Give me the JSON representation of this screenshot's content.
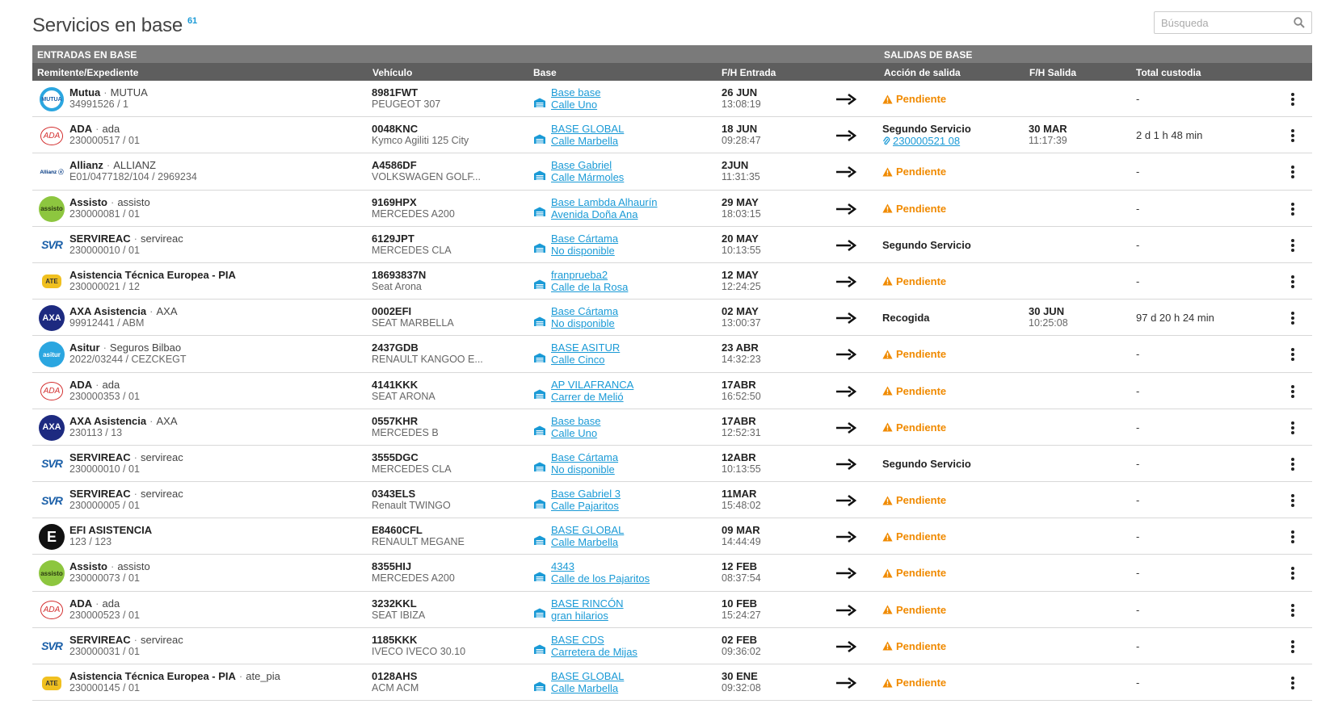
{
  "header": {
    "title": "Servicios en base",
    "count": "61",
    "search_placeholder": "Búsqueda"
  },
  "table": {
    "groups": {
      "entries": "ENTRADAS EN BASE",
      "exits": "SALIDAS DE BASE"
    },
    "columns": {
      "sender": "Remitente/Expediente",
      "vehicle": "Vehículo",
      "base": "Base",
      "entry": "F/H Entrada",
      "action": "Acción de salida",
      "exit": "F/H Salida",
      "total": "Total custodia"
    },
    "rows": [
      {
        "logo": "mutua",
        "name": "Mutua",
        "alias": "MUTUA",
        "file": "34991526 / 1",
        "plate": "8981FWT",
        "model": "PEUGEOT 307",
        "base": "Base base",
        "address": "Calle Uno",
        "entry_date": "26 JUN",
        "entry_time": "13:08:19",
        "action": "Pendiente",
        "action_type": "pending",
        "action_link": "",
        "exit_date": "",
        "exit_time": "",
        "total": "-"
      },
      {
        "logo": "ada",
        "name": "ADA",
        "alias": "ada",
        "file": "230000517 / 01",
        "plate": "0048KNC",
        "model": "Kymco Agiliti 125 City",
        "base": "BASE GLOBAL",
        "address": "Calle Marbella",
        "entry_date": "18 JUN",
        "entry_time": "09:28:47",
        "action": "Segundo Servicio",
        "action_type": "linked",
        "action_link": "230000521 08",
        "exit_date": "30 MAR",
        "exit_time": "11:17:39",
        "total": "2 d 1 h 48 min"
      },
      {
        "logo": "allianz",
        "name": "Allianz",
        "alias": "ALLIANZ",
        "file": "E01/0477182/104 / 2969234",
        "plate": "A4586DF",
        "model": "VOLKSWAGEN GOLF...",
        "base": "Base Gabriel",
        "address": "Calle Mármoles",
        "entry_date": "2JUN",
        "entry_time": "11:31:35",
        "action": "Pendiente",
        "action_type": "pending",
        "action_link": "",
        "exit_date": "",
        "exit_time": "",
        "total": "-"
      },
      {
        "logo": "assisto",
        "name": "Assisto",
        "alias": "assisto",
        "file": "230000081 / 01",
        "plate": "9169HPX",
        "model": "MERCEDES A200",
        "base": "Base Lambda Alhaurín",
        "address": "Avenida Doña Ana",
        "entry_date": "29 MAY",
        "entry_time": "18:03:15",
        "action": "Pendiente",
        "action_type": "pending",
        "action_link": "",
        "exit_date": "",
        "exit_time": "",
        "total": "-"
      },
      {
        "logo": "svr",
        "name": "SERVIREAC",
        "alias": "servireac",
        "file": "230000010 / 01",
        "plate": "6129JPT",
        "model": "MERCEDES CLA",
        "base": "Base Cártama",
        "address": "No disponible",
        "entry_date": "20 MAY",
        "entry_time": "10:13:55",
        "action": "Segundo Servicio",
        "action_type": "text",
        "action_link": "",
        "exit_date": "",
        "exit_time": "",
        "total": "-"
      },
      {
        "logo": "ate",
        "name": "Asistencia Técnica Europea - PIA",
        "alias": "",
        "file": "230000021 / 12",
        "plate": "18693837N",
        "model": "Seat Arona",
        "base": "franprueba2",
        "address": "Calle de la Rosa",
        "entry_date": "12 MAY",
        "entry_time": "12:24:25",
        "action": "Pendiente",
        "action_type": "pending",
        "action_link": "",
        "exit_date": "",
        "exit_time": "",
        "total": "-"
      },
      {
        "logo": "axa",
        "name": "AXA Asistencia",
        "alias": "AXA",
        "file": "99912441 / ABM",
        "plate": "0002EFI",
        "model": "SEAT MARBELLA",
        "base": "Base Cártama",
        "address": "No disponible",
        "entry_date": "02 MAY",
        "entry_time": "13:00:37",
        "action": "Recogida",
        "action_type": "text",
        "action_link": "",
        "exit_date": "30 JUN",
        "exit_time": "10:25:08",
        "total": "97 d 20 h 24 min"
      },
      {
        "logo": "asitur",
        "name": "Asitur",
        "alias": "Seguros Bilbao",
        "file": "2022/03244 / CEZCKEGT",
        "plate": "2437GDB",
        "model": "RENAULT KANGOO E...",
        "base": "BASE ASITUR",
        "address": "Calle Cinco",
        "entry_date": "23 ABR",
        "entry_time": "14:32:23",
        "action": "Pendiente",
        "action_type": "pending",
        "action_link": "",
        "exit_date": "",
        "exit_time": "",
        "total": "-"
      },
      {
        "logo": "ada",
        "name": "ADA",
        "alias": "ada",
        "file": "230000353 / 01",
        "plate": "4141KKK",
        "model": "SEAT ARONA",
        "base": "AP VILAFRANCA",
        "address": "Carrer de Melió",
        "entry_date": "17ABR",
        "entry_time": "16:52:50",
        "action": "Pendiente",
        "action_type": "pending",
        "action_link": "",
        "exit_date": "",
        "exit_time": "",
        "total": "-"
      },
      {
        "logo": "axa",
        "name": "AXA Asistencia",
        "alias": "AXA",
        "file": "230113 / 13",
        "plate": "0557KHR",
        "model": "MERCEDES B",
        "base": "Base base",
        "address": "Calle Uno",
        "entry_date": "17ABR",
        "entry_time": "12:52:31",
        "action": "Pendiente",
        "action_type": "pending",
        "action_link": "",
        "exit_date": "",
        "exit_time": "",
        "total": "-"
      },
      {
        "logo": "svr",
        "name": "SERVIREAC",
        "alias": "servireac",
        "file": "230000010 / 01",
        "plate": "3555DGC",
        "model": "MERCEDES CLA",
        "base": "Base Cártama",
        "address": "No disponible",
        "entry_date": "12ABR",
        "entry_time": "10:13:55",
        "action": "Segundo Servicio",
        "action_type": "text",
        "action_link": "",
        "exit_date": "",
        "exit_time": "",
        "total": "-"
      },
      {
        "logo": "svr",
        "name": "SERVIREAC",
        "alias": "servireac",
        "file": "230000005 / 01",
        "plate": "0343ELS",
        "model": "Renault TWINGO",
        "base": "Base Gabriel 3",
        "address": "Calle Pajaritos",
        "entry_date": "11MAR",
        "entry_time": "15:48:02",
        "action": "Pendiente",
        "action_type": "pending",
        "action_link": "",
        "exit_date": "",
        "exit_time": "",
        "total": "-"
      },
      {
        "logo": "efi",
        "name": "EFI ASISTENCIA",
        "alias": "",
        "file": "123 / 123",
        "plate": "E8460CFL",
        "model": "RENAULT MEGANE",
        "base": "BASE GLOBAL",
        "address": "Calle Marbella",
        "entry_date": "09 MAR",
        "entry_time": "14:44:49",
        "action": "Pendiente",
        "action_type": "pending",
        "action_link": "",
        "exit_date": "",
        "exit_time": "",
        "total": "-"
      },
      {
        "logo": "assisto",
        "name": "Assisto",
        "alias": "assisto",
        "file": "230000073 / 01",
        "plate": "8355HIJ",
        "model": "MERCEDES A200",
        "base": "4343",
        "address": "Calle de los Pajaritos",
        "entry_date": "12 FEB",
        "entry_time": "08:37:54",
        "action": "Pendiente",
        "action_type": "pending",
        "action_link": "",
        "exit_date": "",
        "exit_time": "",
        "total": "-"
      },
      {
        "logo": "ada",
        "name": "ADA",
        "alias": "ada",
        "file": "230000523 / 01",
        "plate": "3232KKL",
        "model": "SEAT IBIZA",
        "base": "BASE RINCÓN",
        "address": "gran hilarios",
        "entry_date": "10 FEB",
        "entry_time": "15:24:27",
        "action": "Pendiente",
        "action_type": "pending",
        "action_link": "",
        "exit_date": "",
        "exit_time": "",
        "total": "-"
      },
      {
        "logo": "svr",
        "name": "SERVIREAC",
        "alias": "servireac",
        "file": "230000031 / 01",
        "plate": "1185KKK",
        "model": "IVECO IVECO 30.10",
        "base": "BASE CDS",
        "address": "Carretera de Mijas",
        "entry_date": "02 FEB",
        "entry_time": "09:36:02",
        "action": "Pendiente",
        "action_type": "pending",
        "action_link": "",
        "exit_date": "",
        "exit_time": "",
        "total": "-"
      },
      {
        "logo": "ate",
        "name": "Asistencia Técnica Europea - PIA",
        "alias": "ate_pia",
        "file": "230000145 / 01",
        "plate": "0128AHS",
        "model": "ACM ACM",
        "base": "BASE GLOBAL",
        "address": "Calle Marbella",
        "entry_date": "30 ENE",
        "entry_time": "09:32:08",
        "action": "Pendiente",
        "action_type": "pending",
        "action_link": "",
        "exit_date": "",
        "exit_time": "",
        "total": "-"
      }
    ]
  },
  "logos": {
    "mutua": {
      "text": "MUTUA",
      "bg": "#ffffff",
      "fg": "#1a5fa8",
      "ring": "#2ba6e0"
    },
    "ada": {
      "text": "ADA",
      "bg": "#ffffff",
      "fg": "#d32f2f",
      "ring": ""
    },
    "allianz": {
      "text": "Allianz ⓐ",
      "bg": "#ffffff",
      "fg": "#003781",
      "ring": ""
    },
    "assisto": {
      "text": "assisto",
      "bg": "#8dc63f",
      "fg": "#2b3a12",
      "ring": ""
    },
    "svr": {
      "text": "SVR",
      "bg": "#ffffff",
      "fg": "#1a5fa8",
      "ring": ""
    },
    "ate": {
      "text": "ATE",
      "bg": "#ffffff",
      "fg": "#b58a00",
      "ring": ""
    },
    "axa": {
      "text": "AXA",
      "bg": "#1d2a80",
      "fg": "#ffffff",
      "ring": ""
    },
    "asitur": {
      "text": "asitur",
      "bg": "#2ba6e0",
      "fg": "#ffffff",
      "ring": ""
    },
    "efi": {
      "text": "E",
      "bg": "#111111",
      "fg": "#ffffff",
      "ring": ""
    }
  },
  "colors": {
    "accent": "#1a9ad6",
    "pending": "#f08a00",
    "header_dark": "#5e5e5e",
    "header_light": "#7a7a7a"
  }
}
